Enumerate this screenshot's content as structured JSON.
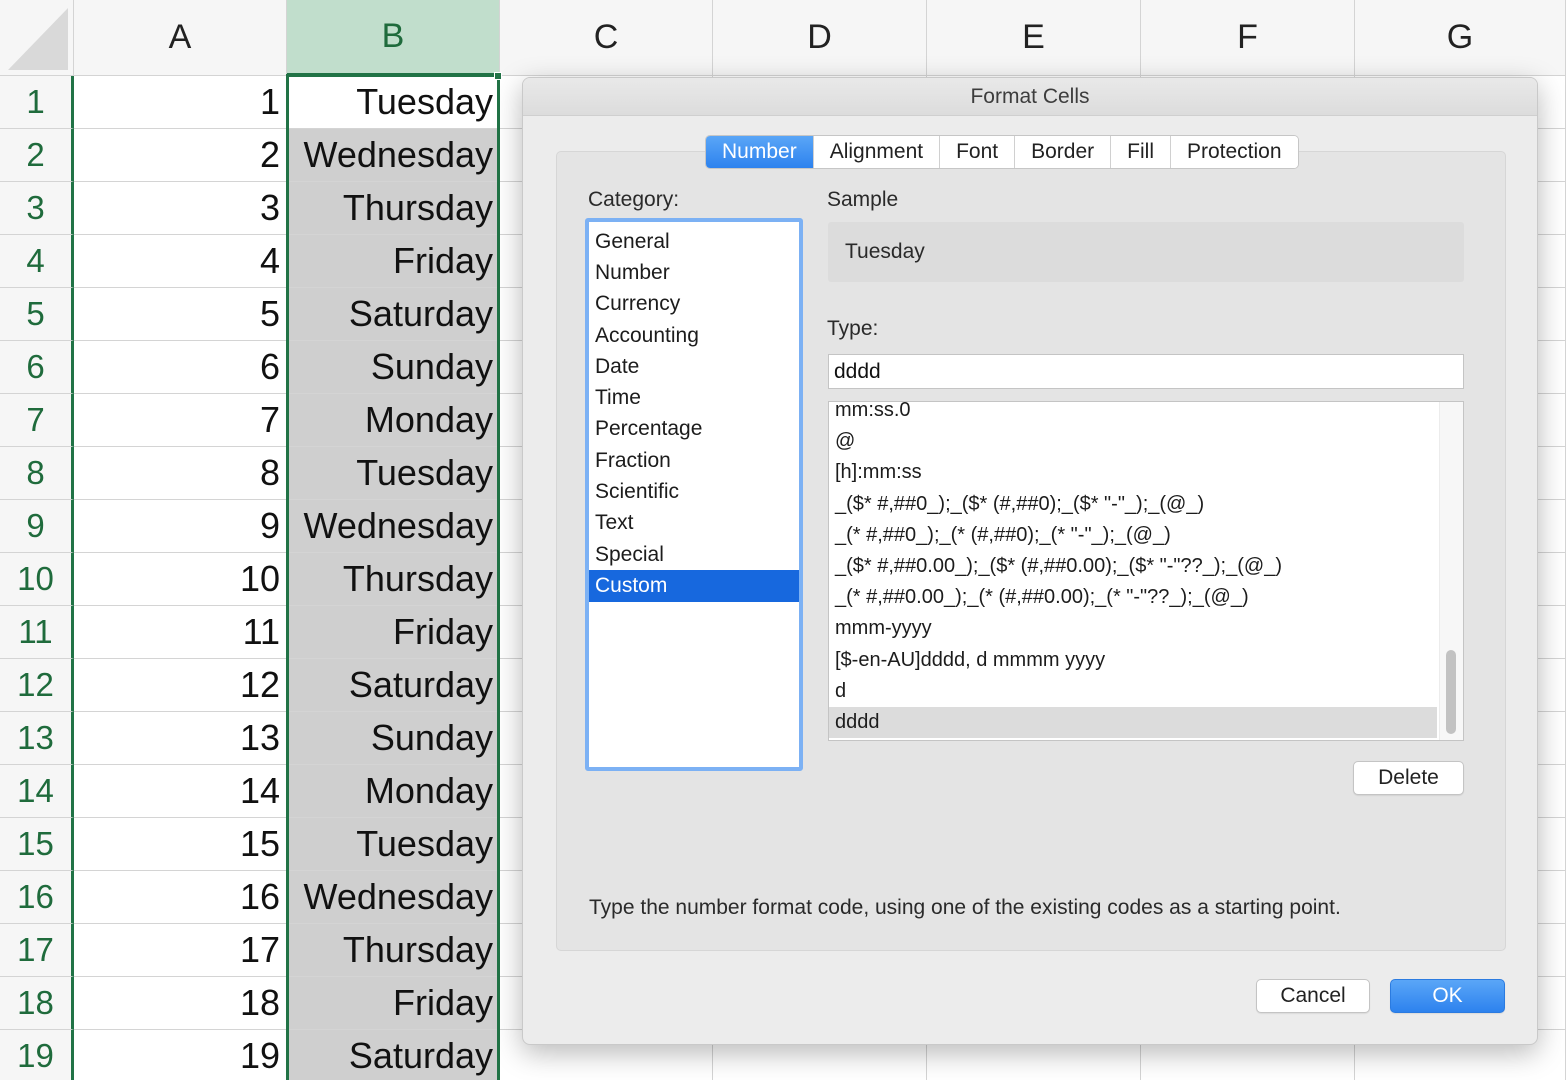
{
  "sheet": {
    "columns": [
      "A",
      "B",
      "C",
      "D",
      "E",
      "F",
      "G"
    ],
    "selected_column": "B",
    "rows": [
      {
        "row": "1",
        "a": "1",
        "b": "Tuesday"
      },
      {
        "row": "2",
        "a": "2",
        "b": "Wednesday"
      },
      {
        "row": "3",
        "a": "3",
        "b": "Thursday"
      },
      {
        "row": "4",
        "a": "4",
        "b": "Friday"
      },
      {
        "row": "5",
        "a": "5",
        "b": "Saturday"
      },
      {
        "row": "6",
        "a": "6",
        "b": "Sunday"
      },
      {
        "row": "7",
        "a": "7",
        "b": "Monday"
      },
      {
        "row": "8",
        "a": "8",
        "b": "Tuesday"
      },
      {
        "row": "9",
        "a": "9",
        "b": "Wednesday"
      },
      {
        "row": "10",
        "a": "10",
        "b": "Thursday"
      },
      {
        "row": "11",
        "a": "11",
        "b": "Friday"
      },
      {
        "row": "12",
        "a": "12",
        "b": "Saturday"
      },
      {
        "row": "13",
        "a": "13",
        "b": "Sunday"
      },
      {
        "row": "14",
        "a": "14",
        "b": "Monday"
      },
      {
        "row": "15",
        "a": "15",
        "b": "Tuesday"
      },
      {
        "row": "16",
        "a": "16",
        "b": "Wednesday"
      },
      {
        "row": "17",
        "a": "17",
        "b": "Thursday"
      },
      {
        "row": "18",
        "a": "18",
        "b": "Friday"
      },
      {
        "row": "19",
        "a": "19",
        "b": "Saturday"
      }
    ],
    "colors": {
      "selection": "#217346",
      "selected_header": "#c1decc",
      "selected_fill": "#cfcfcf"
    }
  },
  "dialog": {
    "title": "Format Cells",
    "tabs": [
      "Number",
      "Alignment",
      "Font",
      "Border",
      "Fill",
      "Protection"
    ],
    "active_tab": "Number",
    "category_label": "Category:",
    "categories": [
      "General",
      "Number",
      "Currency",
      "Accounting",
      "Date",
      "Time",
      "Percentage",
      "Fraction",
      "Scientific",
      "Text",
      "Special",
      "Custom"
    ],
    "selected_category": "Custom",
    "sample_label": "Sample",
    "sample_value": "Tuesday",
    "type_label": "Type:",
    "type_value": "dddd",
    "format_codes": [
      "mm:ss.0",
      "@",
      "[h]:mm:ss",
      "_($* #,##0_);_($* (#,##0);_($* \"-\"_);_(@_)",
      "_(* #,##0_);_(* (#,##0);_(* \"-\"_);_(@_)",
      "_($* #,##0.00_);_($* (#,##0.00);_($* \"-\"??_);_(@_)",
      "_(* #,##0.00_);_(* (#,##0.00);_(* \"-\"??_);_(@_)",
      "mmm-yyyy",
      "[$-en-AU]dddd, d mmmm yyyy",
      "d",
      "dddd"
    ],
    "selected_format": "dddd",
    "delete_label": "Delete",
    "hint": "Type the number format code, using one of the existing codes as a starting point.",
    "cancel_label": "Cancel",
    "ok_label": "OK",
    "colors": {
      "accent": "#2d82ee",
      "list_selection": "#1768de"
    }
  }
}
